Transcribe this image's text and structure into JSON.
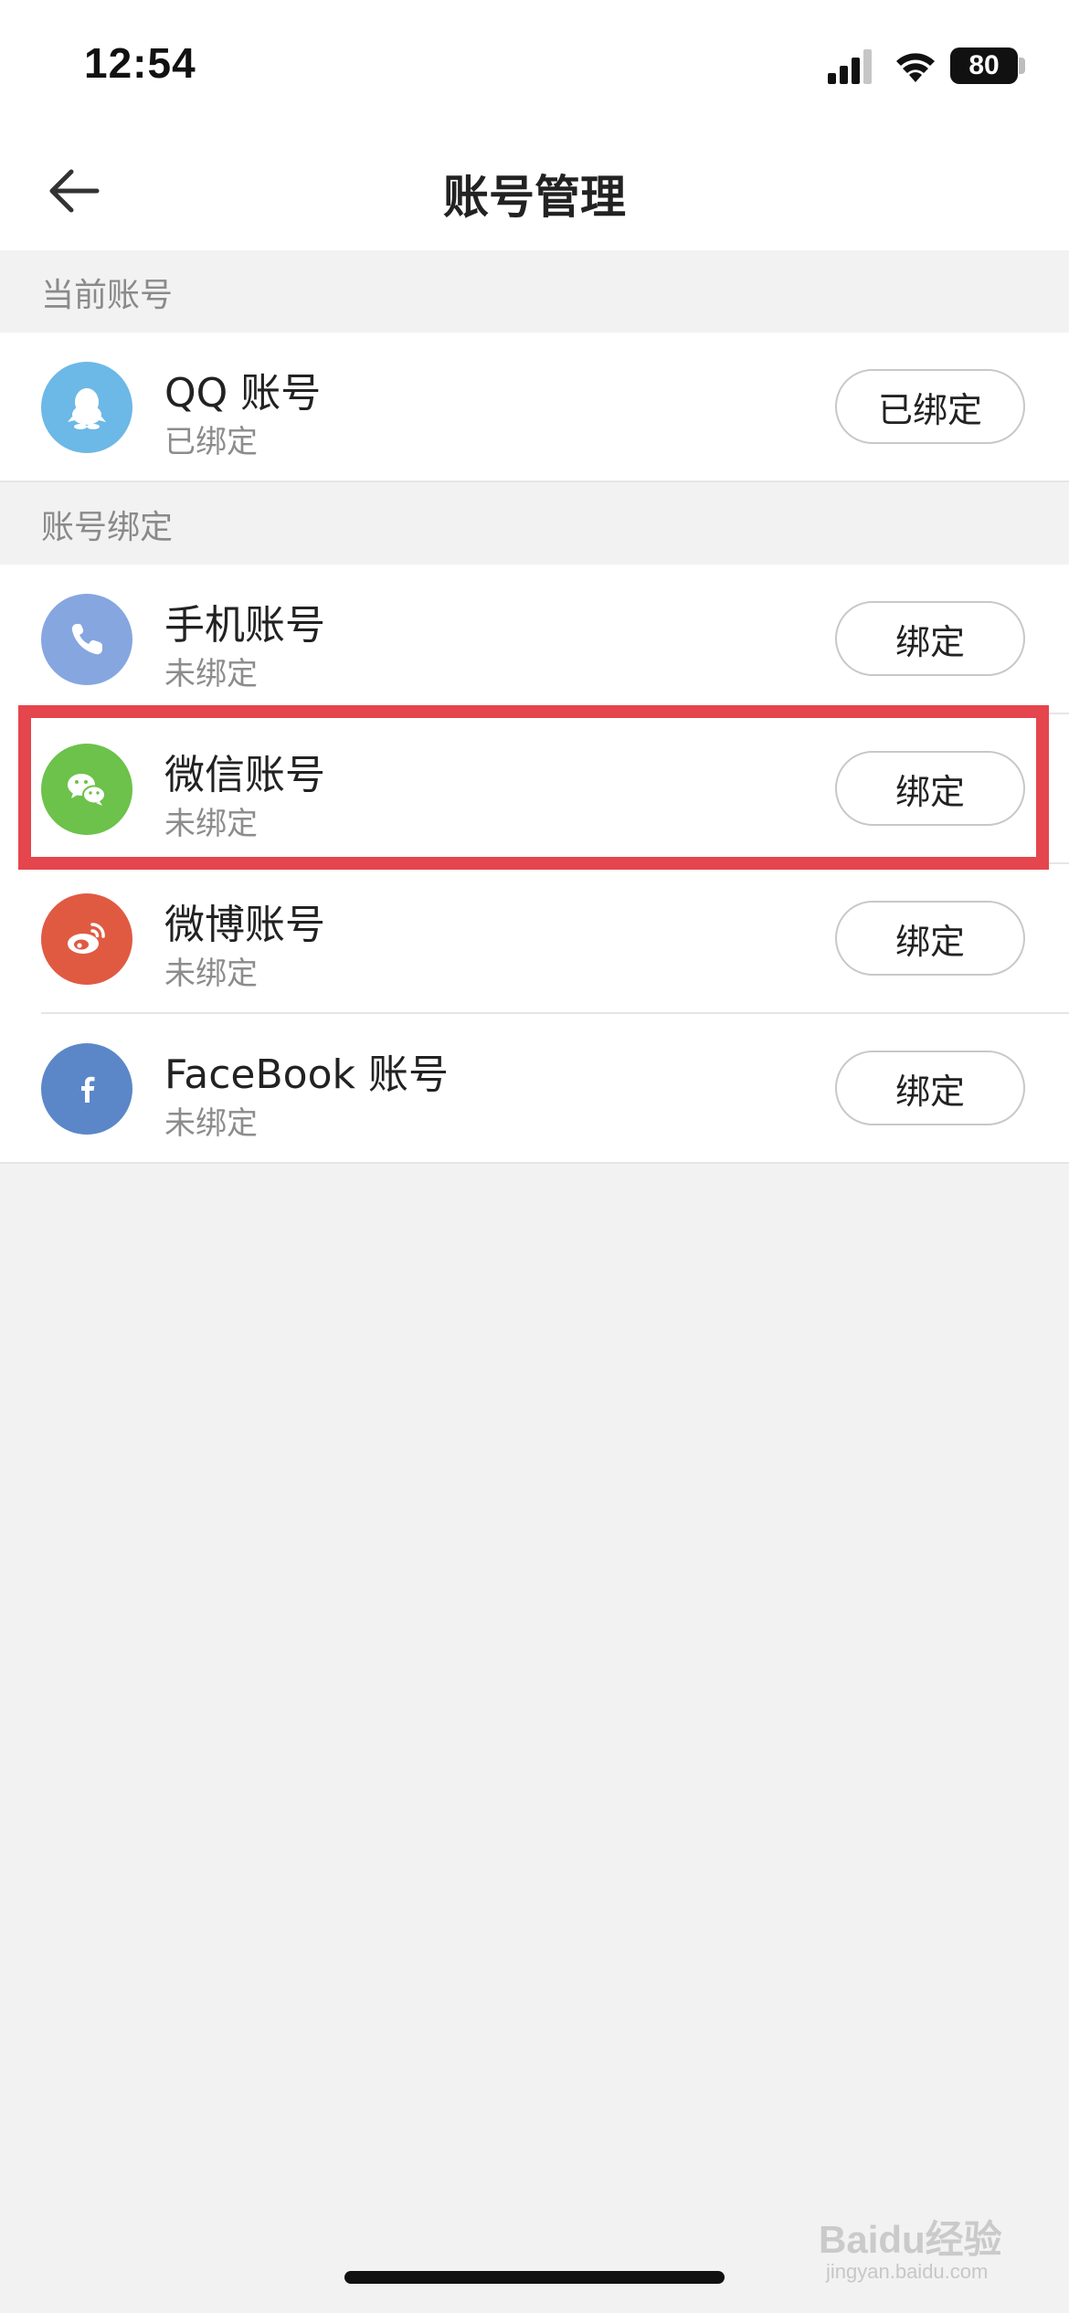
{
  "status_bar": {
    "time": "12:54",
    "battery": "80"
  },
  "nav": {
    "title": "账号管理"
  },
  "sections": {
    "current_header": "当前账号",
    "binding_header": "账号绑定"
  },
  "current_account": {
    "title": "QQ 账号",
    "status": "已绑定",
    "button": "已绑定",
    "icon": "qq-icon",
    "color": "#6cb8e6"
  },
  "bindings": [
    {
      "title": "手机账号",
      "status": "未绑定",
      "button": "绑定",
      "icon": "phone-icon",
      "color": "#86a6e0"
    },
    {
      "title": "微信账号",
      "status": "未绑定",
      "button": "绑定",
      "icon": "wechat-icon",
      "color": "#6cc24a"
    },
    {
      "title": "微博账号",
      "status": "未绑定",
      "button": "绑定",
      "icon": "weibo-icon",
      "color": "#e05a42"
    },
    {
      "title": "FaceBook 账号",
      "status": "未绑定",
      "button": "绑定",
      "icon": "facebook-icon",
      "color": "#5b87c9"
    }
  ],
  "watermark": {
    "logo": "Baidu经验",
    "url": "jingyan.baidu.com"
  },
  "colors": {
    "highlight": "#e5454d",
    "background": "#f2f2f2"
  }
}
